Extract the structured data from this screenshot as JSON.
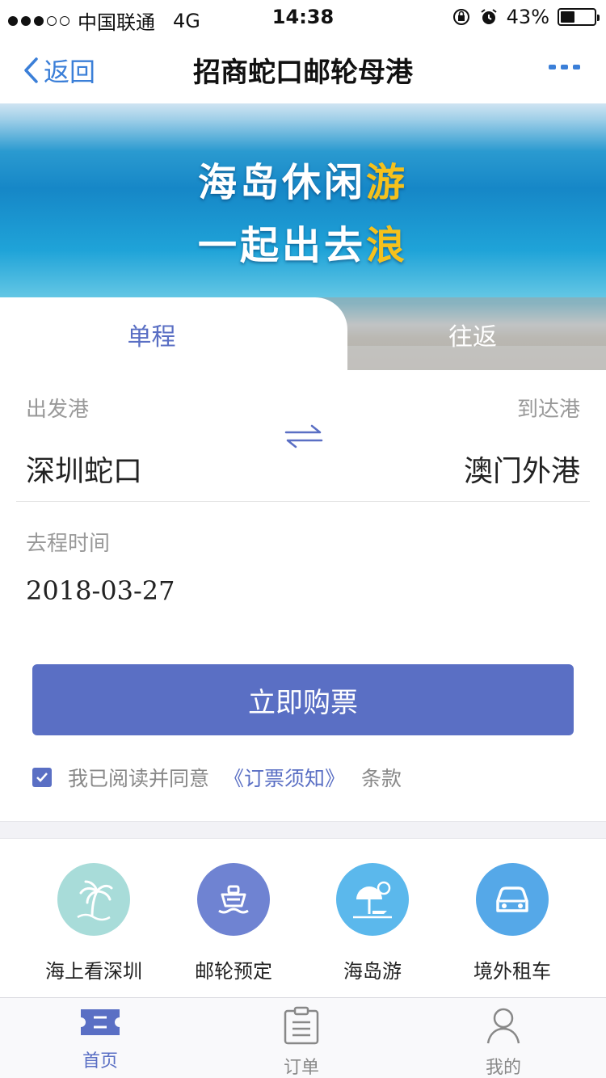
{
  "status_bar": {
    "carrier": "中国联通",
    "network": "4G",
    "time": "14:38",
    "battery": "43%",
    "battery_level": 0.43
  },
  "nav": {
    "back_label": "返回",
    "title": "招商蛇口邮轮母港"
  },
  "banner": {
    "line1_main": "海岛休闲",
    "line1_highlight": "游",
    "line2_main": "一起出去",
    "line2_highlight": "浪"
  },
  "tabs": {
    "single": "单程",
    "round": "往返"
  },
  "form": {
    "depart_label": "出发港",
    "depart_value": "深圳蛇口",
    "arrive_label": "到达港",
    "arrive_value": "澳门外港",
    "date_label": "去程时间",
    "date_value": "2018-03-27"
  },
  "buy_button": "立即购票",
  "agreement": {
    "prefix": "我已阅读并同意",
    "link": "《订票须知》",
    "suffix": "条款",
    "checked": true
  },
  "services": [
    {
      "label": "海上看深圳",
      "icon": "palm-tree-icon",
      "color": "#a8dcd9"
    },
    {
      "label": "邮轮预定",
      "icon": "cruise-ship-icon",
      "color": "#6f83d2"
    },
    {
      "label": "海岛游",
      "icon": "beach-umbrella-icon",
      "color": "#5bb8ec"
    },
    {
      "label": "境外租车",
      "icon": "car-icon",
      "color": "#55a8e8"
    }
  ],
  "tabbar": {
    "home": "首页",
    "orders": "订单",
    "mine": "我的"
  },
  "colors": {
    "accent": "#5a6fc4",
    "nav_link": "#3b7fd8"
  }
}
